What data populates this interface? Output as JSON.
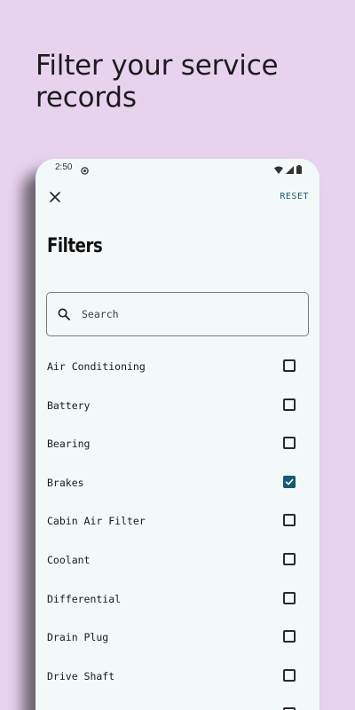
{
  "headline": "Filter your service records",
  "status_bar": {
    "time": "2:50"
  },
  "header": {
    "reset_label": "RESET"
  },
  "title": "Filters",
  "search": {
    "placeholder": "Search"
  },
  "filters": [
    {
      "label": "Air Conditioning",
      "checked": false
    },
    {
      "label": "Battery",
      "checked": false
    },
    {
      "label": "Bearing",
      "checked": false
    },
    {
      "label": "Brakes",
      "checked": true
    },
    {
      "label": "Cabin Air Filter",
      "checked": false
    },
    {
      "label": "Coolant",
      "checked": false
    },
    {
      "label": "Differential",
      "checked": false
    },
    {
      "label": "Drain Plug",
      "checked": false
    },
    {
      "label": "Drive Shaft",
      "checked": false
    },
    {
      "label": "",
      "checked": false
    }
  ],
  "colors": {
    "background": "#e8d3ef",
    "screen": "#f3f9f9",
    "accent": "#155a70"
  },
  "icons": {
    "close": "close-icon",
    "search": "search-icon",
    "checkbox_checked": "check-icon"
  }
}
